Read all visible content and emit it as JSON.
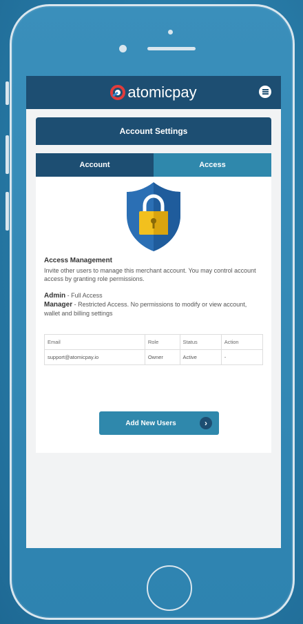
{
  "brand": {
    "name": "atomicpay"
  },
  "page": {
    "title": "Account Settings"
  },
  "tabs": [
    {
      "label": "Account"
    },
    {
      "label": "Access"
    }
  ],
  "access": {
    "section_title": "Access Management",
    "description": "Invite other users to manage this merchant account. You may control account access by granting role permissions.",
    "roles": [
      {
        "name": "Admin",
        "desc": " - Full Access"
      },
      {
        "name": "Manager",
        "desc": " - Restricted Access. No permissions to modify or view account, wallet and billing settings"
      }
    ]
  },
  "users_table": {
    "headers": [
      "Email",
      "Role",
      "Status",
      "Action"
    ],
    "rows": [
      [
        "support@atomicpay.io",
        "Owner",
        "Active",
        "-"
      ]
    ]
  },
  "add_button": {
    "label": "Add New Users"
  },
  "colors": {
    "header_navy": "#1d4e72",
    "accent_teal": "#2f88ac",
    "shield_blue": "#2b6fb4",
    "lock_gold": "#f2c01e"
  }
}
